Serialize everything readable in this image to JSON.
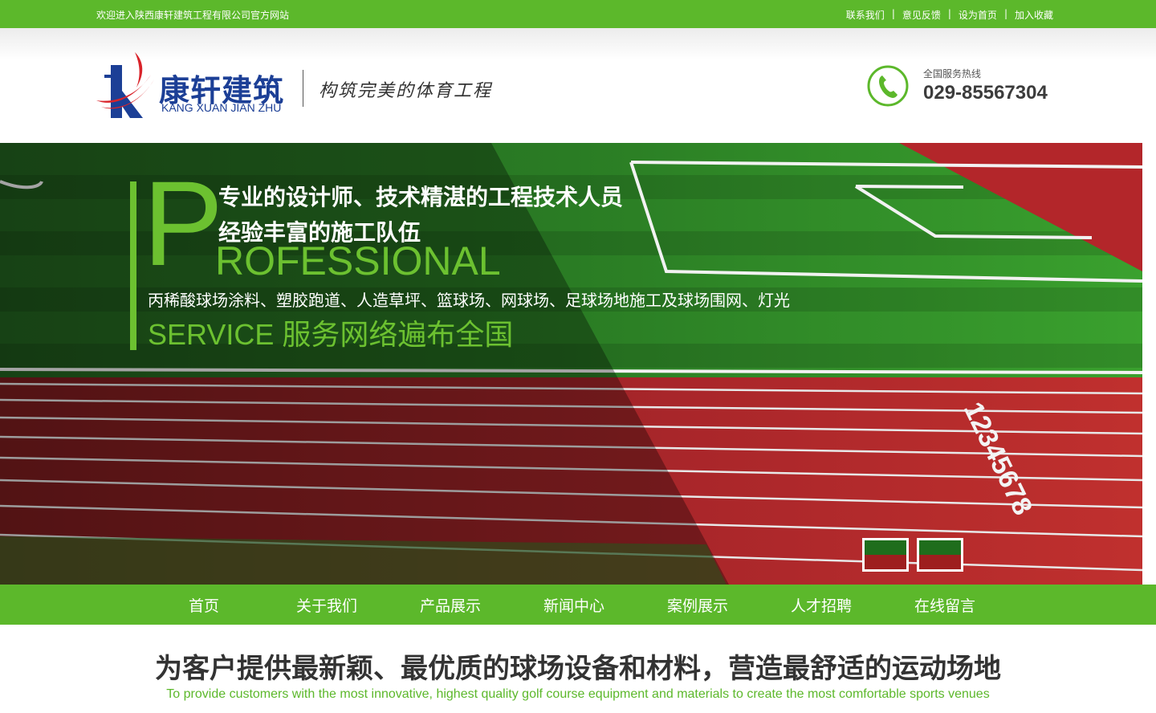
{
  "topbar": {
    "welcome": "欢迎进入陕西康轩建筑工程有限公司官方网站",
    "links": [
      "联系我们",
      "意见反馈",
      "设为首页",
      "加入收藏"
    ],
    "separator": "|"
  },
  "header": {
    "logo_cn": "康轩建筑",
    "logo_en": "KANG XUAN JIAN ZHU",
    "logo_icon": "kx-logo-icon",
    "slogan": "构筑完美的体育工程",
    "hotline_label": "全国服务热线",
    "hotline_number": "029-85567304",
    "phone_icon": "phone-icon"
  },
  "banner": {
    "headline1": "专业的设计师、技术精湛的工程技术人员",
    "headline2": "经验丰富的施工队伍",
    "big_letter": "P",
    "professional": "ROFESSIONAL",
    "products": "丙稀酸球场涂料、塑胶跑道、人造草坪、篮球场、网球场、足球场地施工及球场围网、灯光",
    "service": "SERVICE 服务网络遍布全国",
    "lane_numbers": "12345678"
  },
  "nav": {
    "items": [
      "首页",
      "关于我们",
      "产品展示",
      "新闻中心",
      "案例展示",
      "人才招聘",
      "在线留言"
    ]
  },
  "tagline": {
    "cn": "为客户提供最新颖、最优质的球场设备和材料，营造最舒适的运动场地",
    "en": "To provide customers with the most innovative, highest quality golf course equipment and materials to create the most comfortable sports venues"
  },
  "colors": {
    "brand_green": "#5cb82b",
    "accent_green": "#6cc130",
    "logo_blue": "#1c3f96",
    "track_red": "#b3262a",
    "turf_green": "#2f8a26"
  }
}
